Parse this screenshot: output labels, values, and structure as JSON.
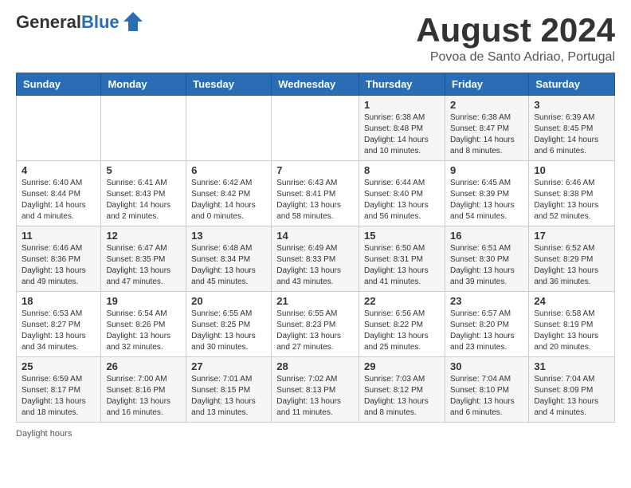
{
  "header": {
    "logo_general": "General",
    "logo_blue": "Blue",
    "title": "August 2024",
    "subtitle": "Povoa de Santo Adriao, Portugal"
  },
  "weekdays": [
    "Sunday",
    "Monday",
    "Tuesday",
    "Wednesday",
    "Thursday",
    "Friday",
    "Saturday"
  ],
  "weeks": [
    [
      {
        "day": "",
        "info": ""
      },
      {
        "day": "",
        "info": ""
      },
      {
        "day": "",
        "info": ""
      },
      {
        "day": "",
        "info": ""
      },
      {
        "day": "1",
        "info": "Sunrise: 6:38 AM\nSunset: 8:48 PM\nDaylight: 14 hours\nand 10 minutes."
      },
      {
        "day": "2",
        "info": "Sunrise: 6:38 AM\nSunset: 8:47 PM\nDaylight: 14 hours\nand 8 minutes."
      },
      {
        "day": "3",
        "info": "Sunrise: 6:39 AM\nSunset: 8:45 PM\nDaylight: 14 hours\nand 6 minutes."
      }
    ],
    [
      {
        "day": "4",
        "info": "Sunrise: 6:40 AM\nSunset: 8:44 PM\nDaylight: 14 hours\nand 4 minutes."
      },
      {
        "day": "5",
        "info": "Sunrise: 6:41 AM\nSunset: 8:43 PM\nDaylight: 14 hours\nand 2 minutes."
      },
      {
        "day": "6",
        "info": "Sunrise: 6:42 AM\nSunset: 8:42 PM\nDaylight: 14 hours\nand 0 minutes."
      },
      {
        "day": "7",
        "info": "Sunrise: 6:43 AM\nSunset: 8:41 PM\nDaylight: 13 hours\nand 58 minutes."
      },
      {
        "day": "8",
        "info": "Sunrise: 6:44 AM\nSunset: 8:40 PM\nDaylight: 13 hours\nand 56 minutes."
      },
      {
        "day": "9",
        "info": "Sunrise: 6:45 AM\nSunset: 8:39 PM\nDaylight: 13 hours\nand 54 minutes."
      },
      {
        "day": "10",
        "info": "Sunrise: 6:46 AM\nSunset: 8:38 PM\nDaylight: 13 hours\nand 52 minutes."
      }
    ],
    [
      {
        "day": "11",
        "info": "Sunrise: 6:46 AM\nSunset: 8:36 PM\nDaylight: 13 hours\nand 49 minutes."
      },
      {
        "day": "12",
        "info": "Sunrise: 6:47 AM\nSunset: 8:35 PM\nDaylight: 13 hours\nand 47 minutes."
      },
      {
        "day": "13",
        "info": "Sunrise: 6:48 AM\nSunset: 8:34 PM\nDaylight: 13 hours\nand 45 minutes."
      },
      {
        "day": "14",
        "info": "Sunrise: 6:49 AM\nSunset: 8:33 PM\nDaylight: 13 hours\nand 43 minutes."
      },
      {
        "day": "15",
        "info": "Sunrise: 6:50 AM\nSunset: 8:31 PM\nDaylight: 13 hours\nand 41 minutes."
      },
      {
        "day": "16",
        "info": "Sunrise: 6:51 AM\nSunset: 8:30 PM\nDaylight: 13 hours\nand 39 minutes."
      },
      {
        "day": "17",
        "info": "Sunrise: 6:52 AM\nSunset: 8:29 PM\nDaylight: 13 hours\nand 36 minutes."
      }
    ],
    [
      {
        "day": "18",
        "info": "Sunrise: 6:53 AM\nSunset: 8:27 PM\nDaylight: 13 hours\nand 34 minutes."
      },
      {
        "day": "19",
        "info": "Sunrise: 6:54 AM\nSunset: 8:26 PM\nDaylight: 13 hours\nand 32 minutes."
      },
      {
        "day": "20",
        "info": "Sunrise: 6:55 AM\nSunset: 8:25 PM\nDaylight: 13 hours\nand 30 minutes."
      },
      {
        "day": "21",
        "info": "Sunrise: 6:55 AM\nSunset: 8:23 PM\nDaylight: 13 hours\nand 27 minutes."
      },
      {
        "day": "22",
        "info": "Sunrise: 6:56 AM\nSunset: 8:22 PM\nDaylight: 13 hours\nand 25 minutes."
      },
      {
        "day": "23",
        "info": "Sunrise: 6:57 AM\nSunset: 8:20 PM\nDaylight: 13 hours\nand 23 minutes."
      },
      {
        "day": "24",
        "info": "Sunrise: 6:58 AM\nSunset: 8:19 PM\nDaylight: 13 hours\nand 20 minutes."
      }
    ],
    [
      {
        "day": "25",
        "info": "Sunrise: 6:59 AM\nSunset: 8:17 PM\nDaylight: 13 hours\nand 18 minutes."
      },
      {
        "day": "26",
        "info": "Sunrise: 7:00 AM\nSunset: 8:16 PM\nDaylight: 13 hours\nand 16 minutes."
      },
      {
        "day": "27",
        "info": "Sunrise: 7:01 AM\nSunset: 8:15 PM\nDaylight: 13 hours\nand 13 minutes."
      },
      {
        "day": "28",
        "info": "Sunrise: 7:02 AM\nSunset: 8:13 PM\nDaylight: 13 hours\nand 11 minutes."
      },
      {
        "day": "29",
        "info": "Sunrise: 7:03 AM\nSunset: 8:12 PM\nDaylight: 13 hours\nand 8 minutes."
      },
      {
        "day": "30",
        "info": "Sunrise: 7:04 AM\nSunset: 8:10 PM\nDaylight: 13 hours\nand 6 minutes."
      },
      {
        "day": "31",
        "info": "Sunrise: 7:04 AM\nSunset: 8:09 PM\nDaylight: 13 hours\nand 4 minutes."
      }
    ]
  ],
  "footer": {
    "daylight_label": "Daylight hours"
  }
}
